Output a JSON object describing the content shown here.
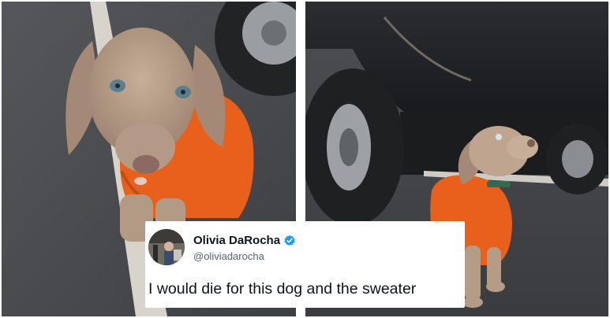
{
  "tweet": {
    "author_name": "Olivia DaRocha",
    "handle": "@oliviadarocha",
    "text": "I would die for this dog and the sweater",
    "verified": true
  },
  "photos": {
    "left_icon": "puppy-in-orange-sweater-icon",
    "right_icon": "puppy-sitting-by-car-icon"
  },
  "colors": {
    "verified_badge": "#1d9bf0",
    "sweater": "#e8601c",
    "puppy_fur": "#b59c86"
  }
}
